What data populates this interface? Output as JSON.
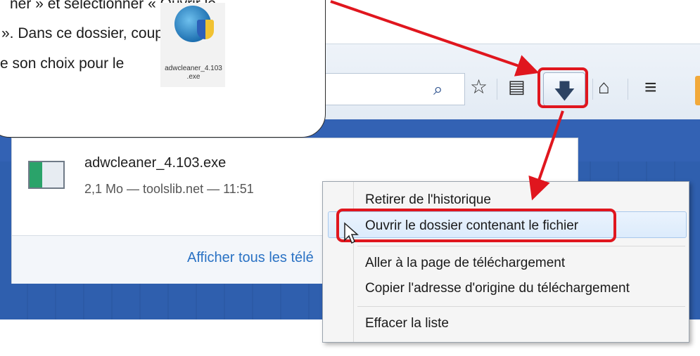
{
  "callout": {
    "lines": [
      "ner » et sélectionner « Ouvrir le",
      "». Dans ce dossier, couper",
      "e son choix pour le"
    ],
    "exe_label": "adwcleaner_4.103\n.exe"
  },
  "toolbar": {
    "icons": [
      "search-icon",
      "star-icon",
      "reading-list-icon",
      "download-icon",
      "home-icon",
      "menu-icon"
    ]
  },
  "download_panel": {
    "file_name": "adwcleaner_4.103.exe",
    "file_meta": "2,1 Mo — toolslib.net — 11:51",
    "show_all_label": "Afficher tous les télé"
  },
  "context_menu": {
    "items": [
      "Retirer de l'historique",
      "Ouvrir le dossier contenant le fichier",
      "Aller à la page de téléchargement",
      "Copier l'adresse d'origine du téléchargement",
      "Effacer la liste"
    ]
  },
  "colors": {
    "annotation_red": "#e0161e",
    "link_blue": "#2a72c4",
    "page_blue": "#3362b4"
  }
}
